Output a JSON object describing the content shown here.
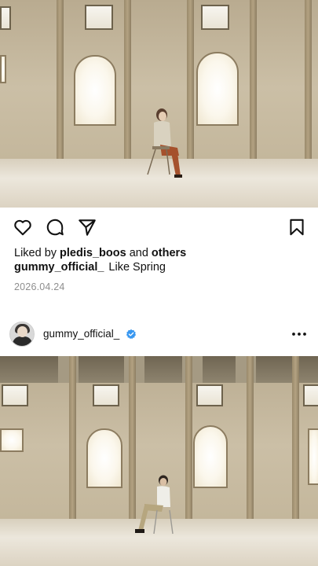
{
  "post": {
    "liked_prefix": "Liked by",
    "liked_user": "pledis_boos",
    "liked_and": "and",
    "liked_others": "others",
    "caption_user": "gummy_official_",
    "caption_text": "Like Spring",
    "date": "2026.04.24"
  },
  "next_post": {
    "username": "gummy_official_",
    "verified": true
  },
  "icons": {
    "like": "heart-icon",
    "comment": "comment-icon",
    "share": "send-icon",
    "save": "bookmark-icon",
    "more": "more-options-icon",
    "verified": "verified-badge-icon"
  },
  "colors": {
    "text": "#111111",
    "muted": "#8e8e8e",
    "verified_blue": "#3897f0"
  }
}
